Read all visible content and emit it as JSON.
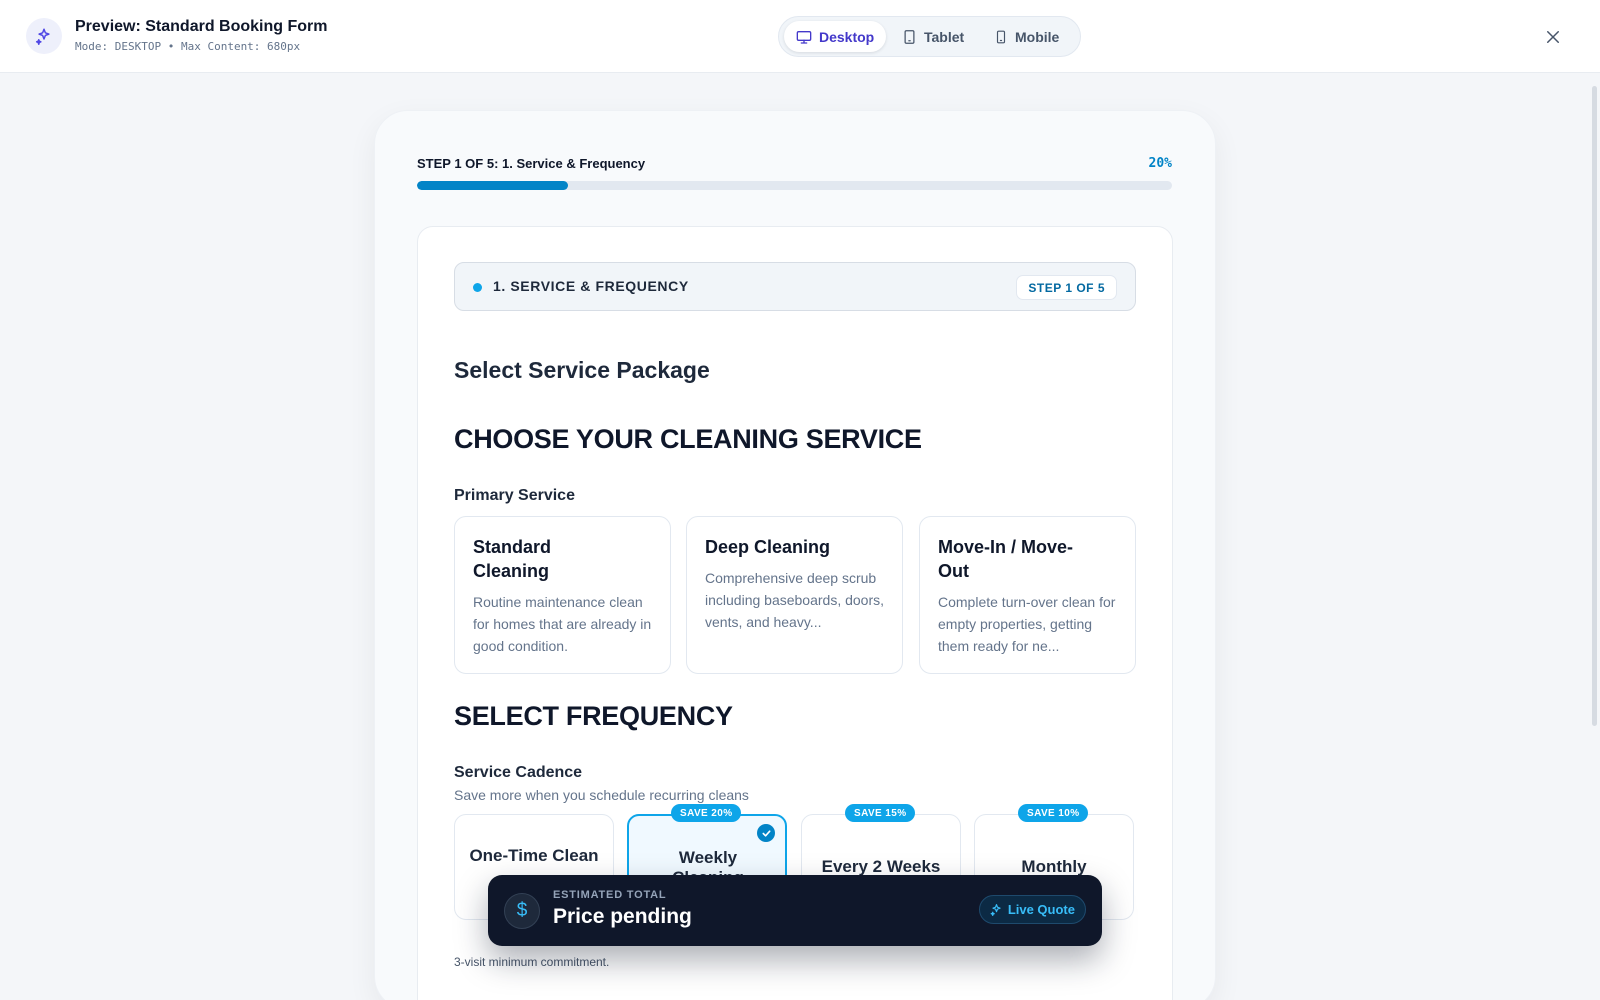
{
  "header": {
    "title": "Preview: Standard Booking Form",
    "subtitle": "Mode: DESKTOP • Max Content: 680px",
    "logo_icon": "sparkles-icon",
    "devices": [
      {
        "label": "Desktop",
        "icon": "monitor-icon",
        "active": true
      },
      {
        "label": "Tablet",
        "icon": "tablet-icon",
        "active": false
      },
      {
        "label": "Mobile",
        "icon": "smartphone-icon",
        "active": false
      }
    ],
    "close_icon": "close-icon"
  },
  "progress": {
    "step_label": "STEP 1 OF 5:  1. Service & Frequency",
    "percent_label": "20%",
    "fraction": 0.2
  },
  "section": {
    "title": "1. SERVICE & FREQUENCY",
    "step_pill": "STEP 1 OF 5"
  },
  "form": {
    "package_heading": "Select Service Package",
    "choose_heading": "CHOOSE YOUR CLEANING SERVICE",
    "primary_label": "Primary Service",
    "services": [
      {
        "name": "Standard Cleaning",
        "desc": "Routine maintenance clean for homes that are already in good condition."
      },
      {
        "name": "Deep Cleaning",
        "desc": "Comprehensive deep scrub including baseboards, doors, vents, and heavy..."
      },
      {
        "name": "Move-In / Move-Out",
        "desc": "Complete turn-over clean for empty properties, getting them ready for ne..."
      }
    ],
    "frequency_heading": "SELECT FREQUENCY",
    "cadence_label": "Service Cadence",
    "cadence_help": "Save more when you schedule recurring cleans",
    "frequencies": [
      {
        "name": "One-Time Clean",
        "badge": "",
        "selected": false
      },
      {
        "name": "Weekly Cleaning",
        "badge": "SAVE 20%",
        "selected": true
      },
      {
        "name": "Every 2 Weeks",
        "badge": "SAVE 15%",
        "selected": false
      },
      {
        "name": "Monthly",
        "badge": "SAVE 10%",
        "selected": false
      }
    ],
    "min_commitment": "3-visit minimum commitment."
  },
  "total_bar": {
    "label": "ESTIMATED TOTAL",
    "value": "Price pending",
    "live_quote": "Live Quote",
    "icon": "dollar-icon"
  },
  "colors": {
    "accent": "#0284c7",
    "badge": "#0ea5e9",
    "active_tab": "#4338ca",
    "total_bar_bg": "#0f172a"
  }
}
